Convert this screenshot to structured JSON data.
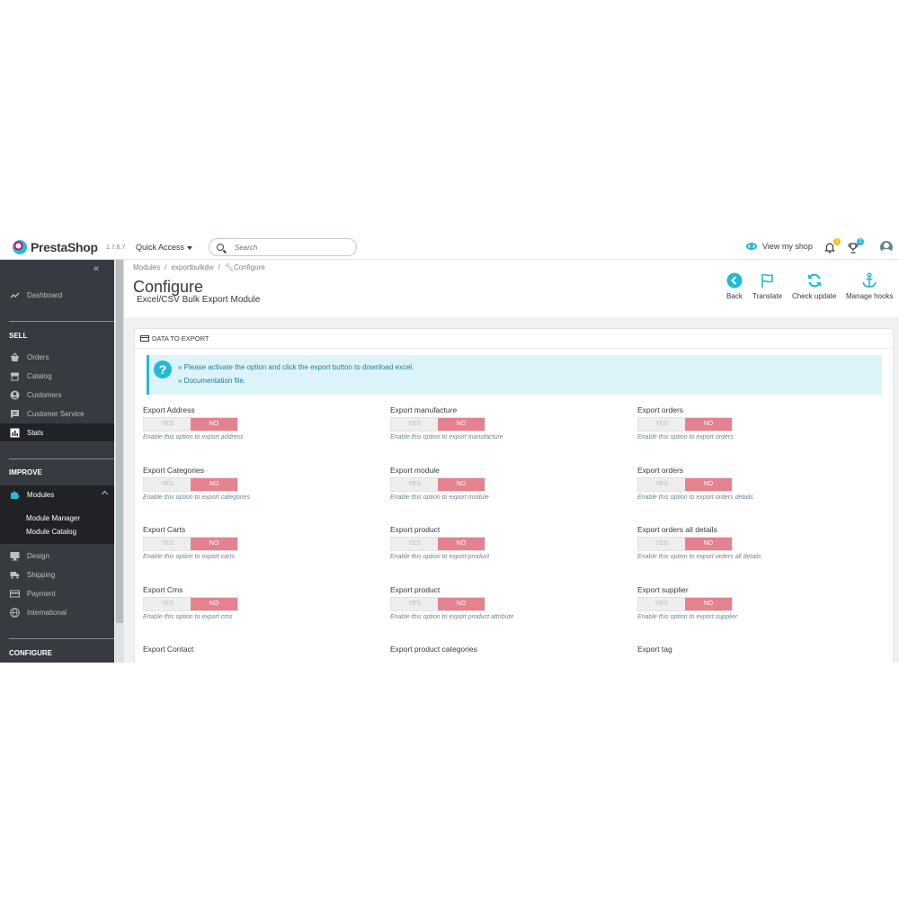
{
  "header": {
    "brand": "PrestaShop",
    "version": "1.7.6.7",
    "quick_access": "Quick Access",
    "search_placeholder": "Search",
    "view_shop": "View my shop",
    "notif_badge": "1",
    "orders_badge": "2"
  },
  "sidebar": {
    "dashboard": "Dashboard",
    "sell_title": "SELL",
    "sell_items": [
      "Orders",
      "Catalog",
      "Customers",
      "Customer Service",
      "Stats"
    ],
    "improve_title": "IMPROVE",
    "modules": "Modules",
    "module_sub": [
      "Module Manager",
      "Module Catalog"
    ],
    "improve_items": [
      "Design",
      "Shipping",
      "Payment",
      "International"
    ],
    "configure_title": "CONFIGURE"
  },
  "page": {
    "breadcrumb": [
      "Modules",
      "/",
      "exportbulkdw",
      "/",
      "Configure"
    ],
    "title": "Configure",
    "subtitle": "Excel/CSV Bulk Export Module",
    "toolbar": {
      "back": "Back",
      "translate": "Translate",
      "check_update": "Check update",
      "manage_hooks": "Manage hooks"
    }
  },
  "panel": {
    "title": "DATA TO EXPORT",
    "alert_line1": "» Please activate the option and click the export button to download excel.",
    "alert_line2": "» Documentation file.",
    "yes_label": "YES",
    "no_label": "NO",
    "options": [
      [
        {
          "label": "Export Address",
          "help": "Enable this option to export address"
        },
        {
          "label": "Export Categories",
          "help": "Enable this option to export categories"
        },
        {
          "label": "Export Carts",
          "help": "Enable this option to export carts"
        },
        {
          "label": "Export Cms",
          "help": "Enable this option to export cms"
        },
        {
          "label": "Export Contact",
          "help": ""
        }
      ],
      [
        {
          "label": "Export manufacture",
          "help": "Enable this option to export manufacture"
        },
        {
          "label": "Export module",
          "help": "Enable this option to export module"
        },
        {
          "label": "Export product",
          "help": "Enable this option to export product"
        },
        {
          "label": "Export product",
          "help": "Enable this option to export product attribute"
        },
        {
          "label": "Export product categories",
          "help": ""
        }
      ],
      [
        {
          "label": "Export orders",
          "help": "Enable this option to export orders"
        },
        {
          "label": "Export orders",
          "help": "Enable this option to export orders details"
        },
        {
          "label": "Export orders all details",
          "help": "Enable this option to export orders all details"
        },
        {
          "label": "Export supplier",
          "help": "Enable this option to export supplier"
        },
        {
          "label": "Export tag",
          "help": ""
        }
      ]
    ]
  },
  "colors": {
    "accent": "#25b9d7",
    "switch_no": "#e4838f",
    "sidebar_bg": "#363a41"
  }
}
